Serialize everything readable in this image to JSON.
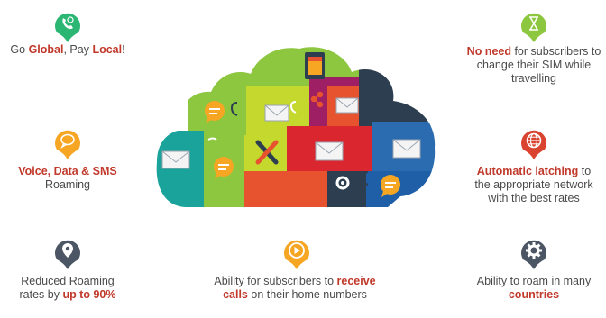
{
  "features": [
    {
      "id": "go-global",
      "icon": "phone-icon",
      "color": "#2bb673",
      "parts": [
        {
          "t": "Go ",
          "h": false
        },
        {
          "t": "Global",
          "h": true
        },
        {
          "t": ", Pay ",
          "h": false
        },
        {
          "t": "Local",
          "h": true
        },
        {
          "t": "!",
          "h": false
        }
      ]
    },
    {
      "id": "voice-data-sms",
      "icon": "chat-bubble-icon",
      "color": "#f6a623",
      "parts": [
        {
          "t": "Voice, Data & SMS",
          "h": true
        },
        {
          "t": " Roaming",
          "h": false
        }
      ]
    },
    {
      "id": "reduced-rates",
      "icon": "location-icon",
      "color": "#4b5563",
      "parts": [
        {
          "t": "Reduced Roaming rates by ",
          "h": false
        },
        {
          "t": "up to 90%",
          "h": true
        }
      ]
    },
    {
      "id": "receive-calls",
      "icon": "play-icon",
      "color": "#f6a623",
      "parts": [
        {
          "t": "Ability for subscribers to ",
          "h": false
        },
        {
          "t": "receive calls",
          "h": true
        },
        {
          "t": " on",
          "h": false
        },
        {
          "t": " their home numbers",
          "h": false
        }
      ]
    },
    {
      "id": "no-sim-change",
      "icon": "hourglass-icon",
      "color": "#8dc63f",
      "parts": [
        {
          "t": "No need",
          "h": true
        },
        {
          "t": " for subscribers to change their SIM while travelling",
          "h": false
        }
      ]
    },
    {
      "id": "auto-latching",
      "icon": "globe-icon",
      "color": "#d9432f",
      "parts": [
        {
          "t": "Automatic latching",
          "h": true
        },
        {
          "t": " to the appropriate network with the best rates",
          "h": false
        }
      ]
    },
    {
      "id": "roam-countries",
      "icon": "gear-icon",
      "color": "#4b5563",
      "parts": [
        {
          "t": "Ability to roam in many ",
          "h": false
        },
        {
          "t": "countries",
          "h": true
        }
      ]
    }
  ],
  "colors": {
    "highlight": "#c0392b",
    "text": "#4a4a4a"
  }
}
